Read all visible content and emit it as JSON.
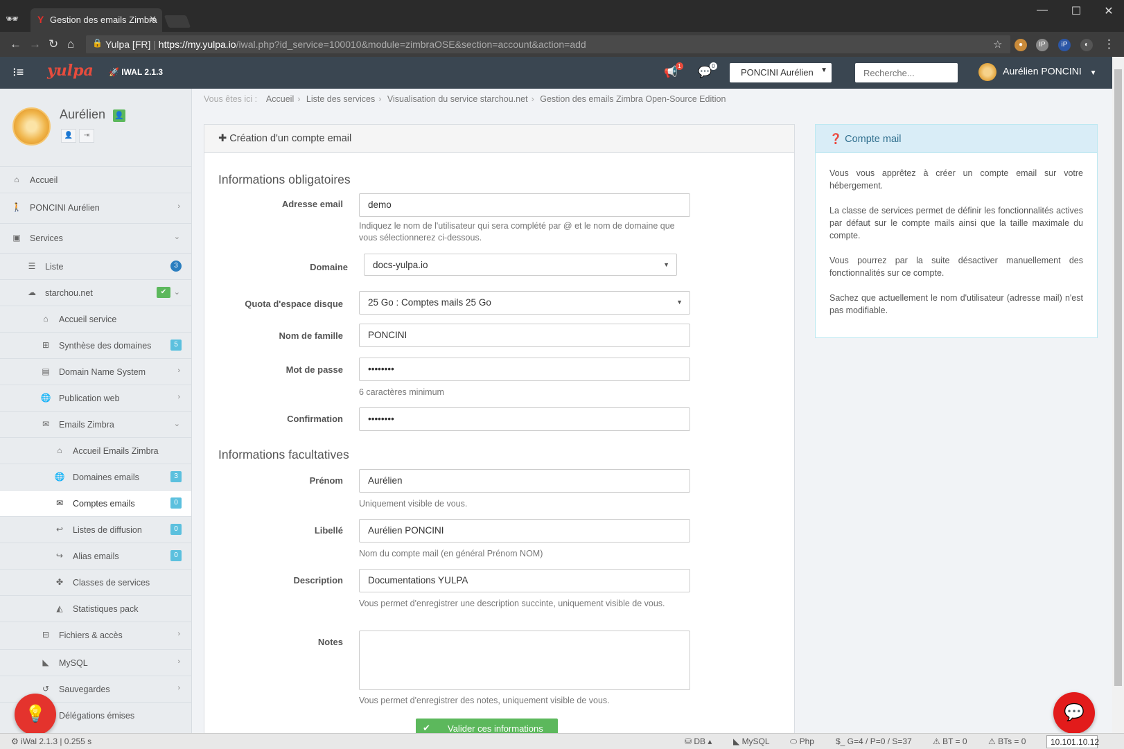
{
  "browser": {
    "tab_title": "Gestion des emails Zimbra",
    "tab_favicon": "Y",
    "url_owner": "Yulpa [FR]",
    "url_scheme": "https://",
    "url_host": "my.yulpa.io",
    "url_path": "/iwal.php?id_service=100010&module=zimbraOSE&section=account&action=add"
  },
  "header": {
    "logo": "yulpa",
    "version": "IWAL 2.1.3",
    "notif_count_1": "1",
    "notif_count_2": "0",
    "account_select": "PONCINI Aurélien",
    "search_placeholder": "Recherche...",
    "user_name": "Aurélien PONCINI"
  },
  "profile": {
    "name": "Aurélien"
  },
  "sidebar": {
    "items": [
      {
        "label": "Accueil"
      },
      {
        "label": "PONCINI Aurélien"
      },
      {
        "label": "Services"
      },
      {
        "label": "Liste",
        "count": "3"
      },
      {
        "label": "starchou.net"
      },
      {
        "label": "Accueil service"
      },
      {
        "label": "Synthèse des domaines",
        "count": "5"
      },
      {
        "label": "Domain Name System"
      },
      {
        "label": "Publication web"
      },
      {
        "label": "Emails Zimbra"
      },
      {
        "label": "Accueil Emails Zimbra"
      },
      {
        "label": "Domaines emails",
        "count": "3"
      },
      {
        "label": "Comptes emails",
        "count": "0"
      },
      {
        "label": "Listes de diffusion",
        "count": "0"
      },
      {
        "label": "Alias emails",
        "count": "0"
      },
      {
        "label": "Classes de services"
      },
      {
        "label": "Statistiques pack"
      },
      {
        "label": "Fichiers & accès"
      },
      {
        "label": "MySQL"
      },
      {
        "label": "Sauvegardes"
      },
      {
        "label": "Délégations émises"
      }
    ]
  },
  "breadcrumb": {
    "prefix": "Vous êtes ici :",
    "items": [
      "Accueil",
      "Liste des services",
      "Visualisation du service starchou.net",
      "Gestion des emails Zimbra Open-Source Edition"
    ]
  },
  "form": {
    "title": "Création d'un compte email",
    "section_required": "Informations obligatoires",
    "section_optional": "Informations facultatives",
    "email_label": "Adresse email",
    "email_value": "demo",
    "email_help": "Indiquez le nom de l'utilisateur qui sera complété par @ et le nom de domaine que vous sélectionnerez ci-dessous.",
    "domain_label": "Domaine",
    "domain_value": "docs-yulpa.io",
    "quota_label": "Quota d'espace disque",
    "quota_value": "25 Go : Comptes mails 25 Go",
    "lastname_label": "Nom de famille",
    "lastname_value": "PONCINI",
    "password_label": "Mot de passe",
    "password_value": "••••••••",
    "password_help": "6 caractères minimum",
    "confirm_label": "Confirmation",
    "confirm_value": "••••••••",
    "firstname_label": "Prénom",
    "firstname_value": "Aurélien",
    "firstname_help": "Uniquement visible de vous.",
    "label_label": "Libellé",
    "label_value": "Aurélien PONCINI",
    "label_help": "Nom du compte mail (en général Prénom NOM)",
    "desc_label": "Description",
    "desc_value": "Documentations YULPA",
    "desc_help": "Vous permet d'enregistrer une description succinte, uniquement visible de vous.",
    "notes_label": "Notes",
    "notes_help": "Vous permet d'enregistrer des notes, uniquement visible de vous.",
    "submit_label": "Valider ces informations"
  },
  "info": {
    "title": "Compte mail",
    "p1": "Vous vous apprêtez à créer un compte email sur votre hébergement.",
    "p2": "La classe de services permet de définir les fonctionnalités actives par défaut sur le compte mails ainsi que la taille maximale du compte.",
    "p3": "Vous pourrez par la suite désactiver manuellement des fonctionnalités sur ce compte.",
    "p4": "Sachez que actuellement le nom d'utilisateur (adresse mail) n'est pas modifiable."
  },
  "statusbar": {
    "left": "iWal 2.1.3 | 0.255 s",
    "db": "DB",
    "mysql": "MySQL",
    "php": "Php",
    "counts": "$_ G=4 / P=0 / S=37",
    "bt": "BT = 0",
    "bts": "BTs = 0",
    "ip": "10.101.10.12"
  }
}
